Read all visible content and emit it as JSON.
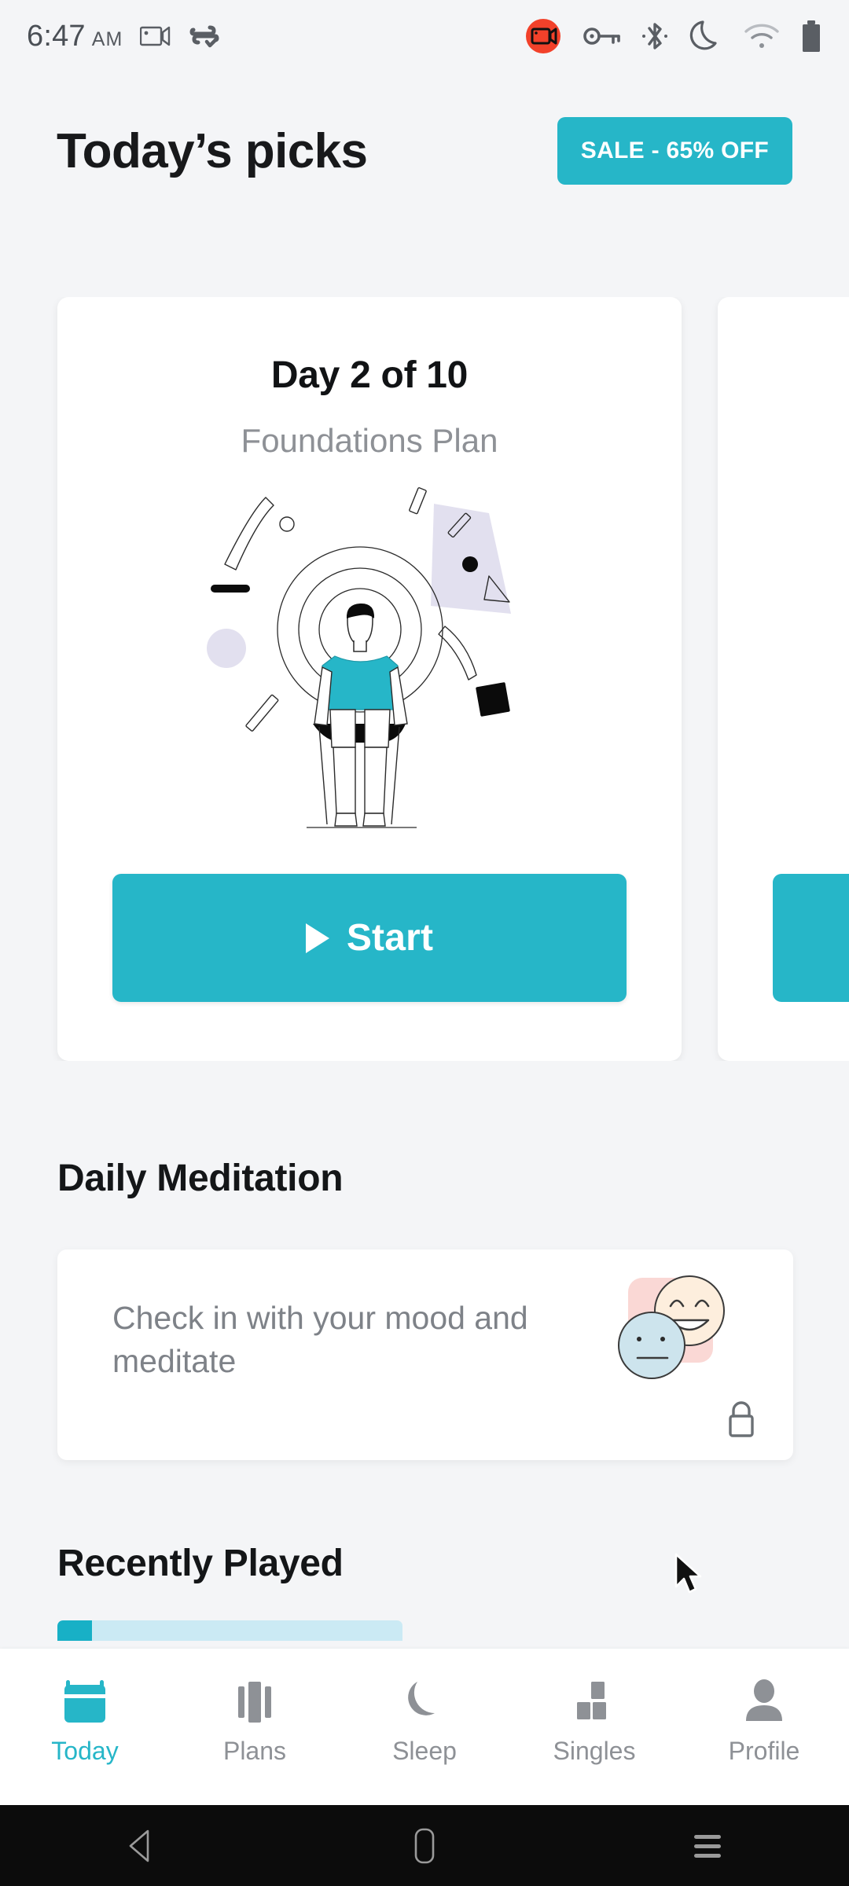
{
  "status_bar": {
    "time": "6:47",
    "ampm": "AM",
    "icons": [
      "screen-record-icon",
      "data-saver-check-icon",
      "screen-recording-active-icon",
      "vpn-key-icon",
      "bluetooth-icon",
      "do-not-disturb-moon-icon",
      "wifi-icon",
      "battery-icon"
    ]
  },
  "header": {
    "title": "Today’s picks",
    "sale_badge": "SALE - 65% OFF"
  },
  "plan_card": {
    "day_text": "Day 2 of 10",
    "plan_name": "Foundations Plan",
    "start_label": "Start",
    "illustration": "person-meditating-illustration"
  },
  "daily_meditation": {
    "section_title": "Daily Meditation",
    "card_text": "Check in with your mood and meditate",
    "illustration": "two-mood-faces-illustration",
    "locked": true,
    "lock_icon": "lock-icon"
  },
  "recently_played": {
    "section_title": "Recently Played",
    "progress_percent": 10
  },
  "bottom_nav": {
    "active_index": 0,
    "items": [
      {
        "label": "Today",
        "icon": "calendar-icon"
      },
      {
        "label": "Plans",
        "icon": "columns-icon"
      },
      {
        "label": "Sleep",
        "icon": "moon-icon"
      },
      {
        "label": "Singles",
        "icon": "blocks-icon"
      },
      {
        "label": "Profile",
        "icon": "person-icon"
      }
    ]
  },
  "android_nav": {
    "back": "back-triangle-icon",
    "home": "home-square-icon",
    "recents": "recent-apps-icon"
  },
  "colors": {
    "accent_teal": "#26b6c8",
    "background": "#f4f5f7",
    "card_white": "#ffffff",
    "muted_text": "#8e9196",
    "title_text": "#141618",
    "record_red": "#f2412a",
    "mood_pink": "#fad8d5",
    "mood_cream": "#fdeedd",
    "mood_blue": "#cde4ed",
    "illo_lavender": "#e2e0ef",
    "progress_track": "#cbeaf4"
  }
}
